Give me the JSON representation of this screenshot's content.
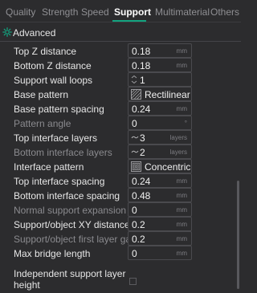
{
  "tabs": [
    {
      "label": "Quality",
      "active": false
    },
    {
      "label": "Strength",
      "active": false
    },
    {
      "label": "Speed",
      "active": false
    },
    {
      "label": "Support",
      "active": true
    },
    {
      "label": "Multimaterial",
      "active": false
    },
    {
      "label": "Others",
      "active": false
    }
  ],
  "accent_color": "#13a37f",
  "section": {
    "title": "Advanced",
    "icon": "gear-icon"
  },
  "rows": {
    "top_z": {
      "label": "Top Z distance",
      "value": "0.18",
      "unit": "mm"
    },
    "bottom_z": {
      "label": "Bottom Z distance",
      "value": "0.18",
      "unit": "mm"
    },
    "wall_loops": {
      "label": "Support wall loops",
      "value": "1"
    },
    "base_pattern": {
      "label": "Base pattern",
      "value": "Rectilinear"
    },
    "base_spacing": {
      "label": "Base pattern spacing",
      "value": "0.24",
      "unit": "mm"
    },
    "pattern_angle": {
      "label": "Pattern angle",
      "value": "0",
      "unit": "°"
    },
    "top_iface_layers": {
      "label": "Top interface layers",
      "value": "3",
      "unit": "layers"
    },
    "bottom_iface_layers": {
      "label": "Bottom interface layers",
      "value": "2",
      "unit": "layers"
    },
    "iface_pattern": {
      "label": "Interface pattern",
      "value": "Concentric"
    },
    "top_iface_spacing": {
      "label": "Top interface spacing",
      "value": "0.24",
      "unit": "mm"
    },
    "bottom_iface_spacing": {
      "label": "Bottom interface spacing",
      "value": "0.48",
      "unit": "mm"
    },
    "normal_expansion": {
      "label": "Normal support expansion",
      "value": "0",
      "unit": "mm"
    },
    "xy_distance": {
      "label": "Support/object XY distance",
      "value": "0.2",
      "unit": "mm"
    },
    "first_layer_gap": {
      "label": "Support/object first layer gap",
      "value": "0.2",
      "unit": "mm"
    },
    "max_bridge": {
      "label": "Max bridge length",
      "value": "0",
      "unit": "mm"
    },
    "independent_height": {
      "label_line1": "Independent support layer",
      "label_line2": "height",
      "checked": false
    }
  }
}
